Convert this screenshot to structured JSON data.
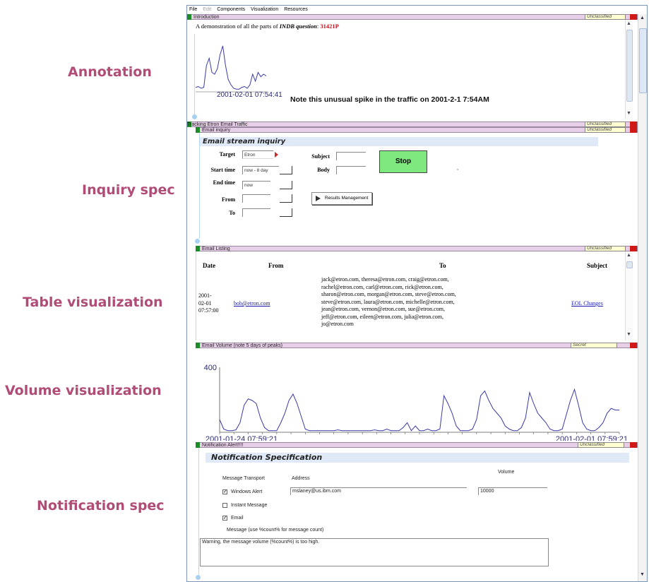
{
  "side_labels": [
    "Annotation",
    "Inquiry spec",
    "Table visualization",
    "Volume visualization",
    "Notification spec"
  ],
  "menu": [
    "File",
    "Edit",
    "Components",
    "Visualization",
    "Resources"
  ],
  "menu_disabled": [
    "Edit"
  ],
  "colors": {
    "accent": "#b04c76",
    "panel_title": "#e7cfe8",
    "green": "#1e8a2a",
    "red": "#d01818",
    "stop_button": "#7fe87f",
    "line": "#3a3aa8"
  },
  "intro": {
    "title": "Introduction",
    "classification": "Unclassified",
    "text_prefix": "A demonstration of all the parts of ",
    "text_question": "INDB question",
    "text_colon": ":",
    "question_id": "31421P",
    "chart_time": "2001-02-01 07:54:41",
    "note": "Note this unusual spike in the traffic on 2001-2-1 7:54AM"
  },
  "tracking": {
    "title": "Tracking Etron Email Traffic",
    "classification": "Unclassified"
  },
  "inquiry": {
    "title": "Email inquiry",
    "classification": "Unclassified",
    "banner": "Email stream inquiry",
    "target_label": "Target",
    "target_value": "Etron",
    "start_label": "Start time",
    "start_value": "now - 8 day",
    "end_label": "End time",
    "end_value": "now",
    "from_label": "From",
    "from_value": "",
    "to_label": "To",
    "to_value": "",
    "subject_label": "Subject",
    "subject_value": "",
    "body_label": "Body",
    "body_value": "",
    "stop_label": "Stop",
    "results_label": "Results Management"
  },
  "listing": {
    "title": "Email Listing",
    "classification": "Unclassified",
    "headers": [
      "Date",
      "From",
      "To",
      "Subject"
    ],
    "rows": [
      {
        "date_lines": [
          "2001-",
          "02-01",
          "07:57:00"
        ],
        "from": "bob@etron.com",
        "to_lines": [
          "jack@etron.com, theresa@etron.com, craig@etron.com,",
          "rachel@etron.com, carl@etron.com, rick@etron.com,",
          "sharon@etron.com, morgan@etron.com, steve@etron.com,",
          "steve@etron.com, laura@etron.com, michelle@etron.com,",
          "jean@etron.com, vernon@etron.com, sue@etron.com,",
          "jeff@etron.com, eileen@etron.com, julia@etron.com,",
          "jo@etron.com"
        ],
        "subject": "EOL Changes"
      }
    ]
  },
  "volume": {
    "title": "Email Volume (note 5 days of peaks)",
    "classification": "Secret"
  },
  "notification": {
    "title": "Notification Alert!!!!",
    "classification": "Unclassified",
    "banner": "Notification Specification",
    "transport_header": "Message Transport",
    "address_header": "Address",
    "volume_header": "Volume",
    "options": [
      {
        "label": "Windows Alert",
        "checked": true
      },
      {
        "label": "Instant Message",
        "checked": false
      },
      {
        "label": "Email",
        "checked": true
      }
    ],
    "address_value": "mslaney@us.ibm.com",
    "volume_value": "10000",
    "message_label": "Message (use %count% for message count)",
    "message_value": "Warning, the message volume (%count%) is too high."
  },
  "chart_data": [
    {
      "type": "line",
      "title": "",
      "x_label_shown": "2001-02-01 07:54:41",
      "series": [
        {
          "values": [
            5,
            6,
            4,
            5,
            30,
            38,
            22,
            20,
            26,
            42,
            52,
            30,
            14,
            8,
            4,
            3,
            3,
            5,
            6,
            4,
            8,
            20,
            12,
            22,
            17,
            20,
            18
          ]
        }
      ],
      "ylim": [
        0,
        60
      ]
    },
    {
      "type": "line",
      "title": "",
      "x_range_labels": [
        "2001-01-24 07:59:21",
        "2001-02-01 07:59:21"
      ],
      "y_tick_label": "400",
      "ylim": [
        0,
        400
      ],
      "series": [
        {
          "values": [
            80,
            20,
            10,
            10,
            15,
            60,
            170,
            210,
            200,
            180,
            90,
            30,
            10,
            10,
            10,
            60,
            120,
            200,
            240,
            180,
            100,
            20,
            10,
            10,
            10,
            10,
            10,
            10,
            10,
            15,
            10,
            10,
            10,
            10,
            10,
            10,
            10,
            10,
            15,
            10,
            10,
            20,
            10,
            10,
            10,
            30,
            60,
            10,
            40,
            10,
            10,
            20,
            10,
            10,
            20,
            230,
            180,
            120,
            40,
            10,
            10,
            10,
            20,
            80,
            230,
            260,
            200,
            150,
            120,
            90,
            40,
            20,
            10,
            10,
            30,
            90,
            250,
            180,
            120,
            90,
            60,
            20,
            10,
            10,
            20,
            110,
            200,
            270,
            170,
            60,
            20,
            10,
            10,
            30,
            60,
            120,
            150,
            140,
            140
          ]
        }
      ]
    }
  ]
}
